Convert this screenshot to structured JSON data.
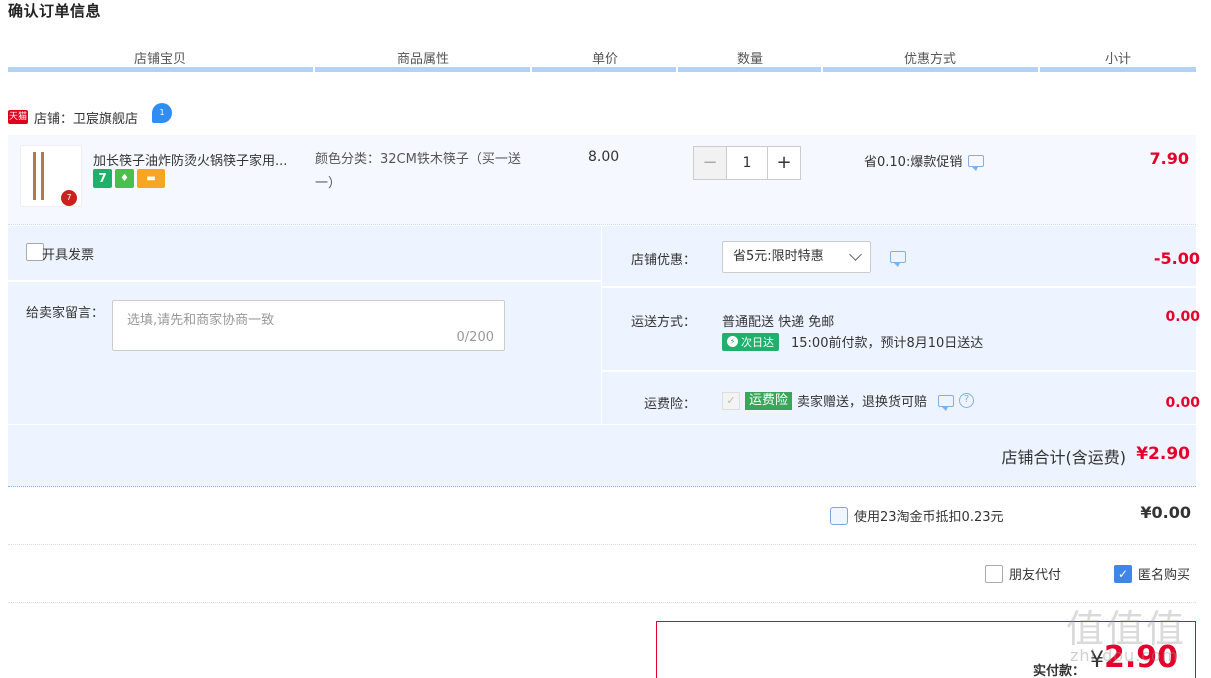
{
  "page_title": "确认订单信息",
  "columns": [
    "店铺宝贝",
    "商品属性",
    "单价",
    "数量",
    "优惠方式",
    "小计"
  ],
  "shop": {
    "platform_badge": "天猫",
    "name": "店铺：卫宸旗舰店",
    "chat_badge": "1"
  },
  "item": {
    "title": "加长筷子油炸防烫火锅筷子家用...",
    "attr": "颜色分类：32CM铁木筷子（买一送一）",
    "price": "8.00",
    "quantity": "1",
    "minus": "−",
    "plus": "+",
    "promo": "省0.10:爆款促销",
    "subtotal": "7.90",
    "badges": [
      "7",
      "♦",
      "▬"
    ],
    "thumb_tag": "7"
  },
  "invoice": {
    "label": "开具发票"
  },
  "message": {
    "label": "给卖家留言：",
    "placeholder": "选填,请先和商家协商一致",
    "counter": "0/200"
  },
  "shop_discount": {
    "label": "店铺优惠：",
    "selected": "省5元:限时特惠",
    "amount": "-5.00"
  },
  "shipping": {
    "label": "运送方式：",
    "method": "普通配送 快递 免邮",
    "next_day_badge": "次日达",
    "eta": "15:00前付款，预计8月10日送达",
    "amount": "0.00"
  },
  "insurance": {
    "label": "运费险：",
    "tag": "运费险",
    "desc": "卖家赠送，退换货可赔",
    "help": "?",
    "amount": "0.00"
  },
  "shop_total": {
    "label": "店铺合计(含运费)",
    "amount": "¥2.90"
  },
  "coins": {
    "label": "使用23淘金币抵扣0.23元",
    "amount": "¥0.00"
  },
  "options": {
    "friend_pay": "朋友代付",
    "anonymous": "匿名购买"
  },
  "payment": {
    "label": "实付款：",
    "yen": "¥",
    "amount": "2.90"
  },
  "watermark": {
    "main": "值值值",
    "sub": "zhi.dou.com"
  }
}
